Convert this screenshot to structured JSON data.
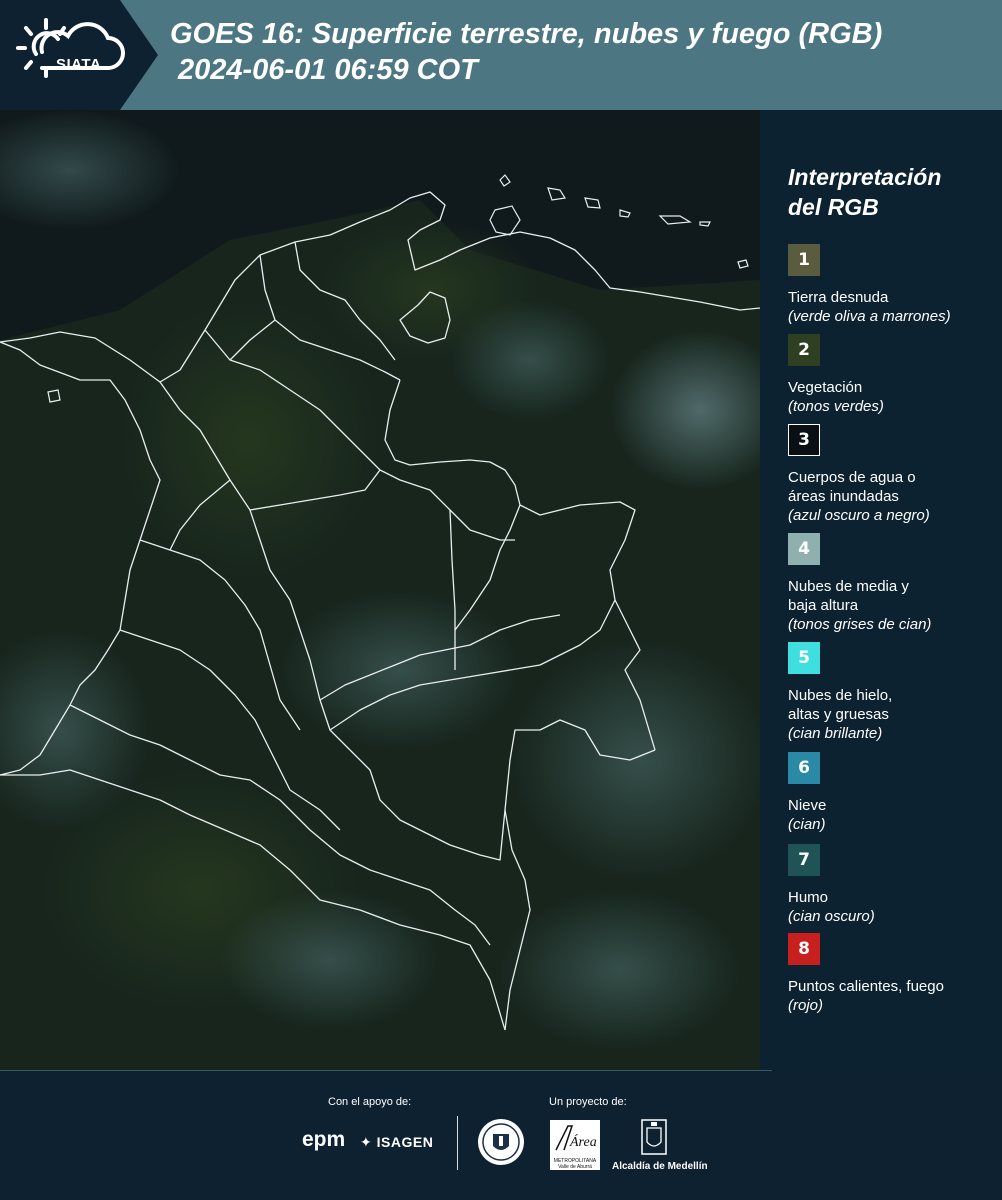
{
  "header": {
    "logo_text": "SIATA",
    "title": "GOES 16: Superficie terrestre, nubes y fuego (RGB)",
    "datetime": "2024-06-01 06:59 COT"
  },
  "legend": {
    "title_line1": "Interpretación",
    "title_line2": "del RGB",
    "items": [
      {
        "number": "1",
        "label": "Tierra desnuda",
        "desc": "(verde oliva a marrones)",
        "color": "#5b5b40"
      },
      {
        "number": "2",
        "label": "Vegetación",
        "desc": "(tonos verdes)",
        "color": "#2f3f22"
      },
      {
        "number": "3",
        "label_l1": "Cuerpos de agua o",
        "label_l2": "áreas inundadas",
        "desc": "(azul oscuro a negro)",
        "color": "#0a0f14"
      },
      {
        "number": "4",
        "label_l1": "Nubes de media y",
        "label_l2": "baja altura",
        "desc": "(tonos grises de cian)",
        "color": "#8fb0ae"
      },
      {
        "number": "5",
        "label_l1": "Nubes de hielo,",
        "label_l2": "altas y gruesas",
        "desc": "(cian brillante)",
        "color": "#3fdfe0"
      },
      {
        "number": "6",
        "label": "Nieve",
        "desc": "(cian)",
        "color": "#2a8aa6"
      },
      {
        "number": "7",
        "label": "Humo",
        "desc": "(cian oscuro)",
        "color": "#1f5355"
      },
      {
        "number": "8",
        "label": "Puntos calientes, fuego",
        "desc": "(rojo)",
        "color": "#c8201f"
      }
    ]
  },
  "footer": {
    "support_label": "Con el apoyo de:",
    "project_label": "Un proyecto de:",
    "epm": "epm",
    "isagen": "ISAGEN",
    "amva_main": "Área",
    "amva_sub": "METROPOLITANA",
    "amva_sub2": "Valle de Aburrá",
    "alcaldia": "Alcaldía de Medellín"
  },
  "icons": {
    "logo": "sun-cloud-icon",
    "seal": "university-seal-icon",
    "alcaldia": "coat-of-arms-icon"
  }
}
